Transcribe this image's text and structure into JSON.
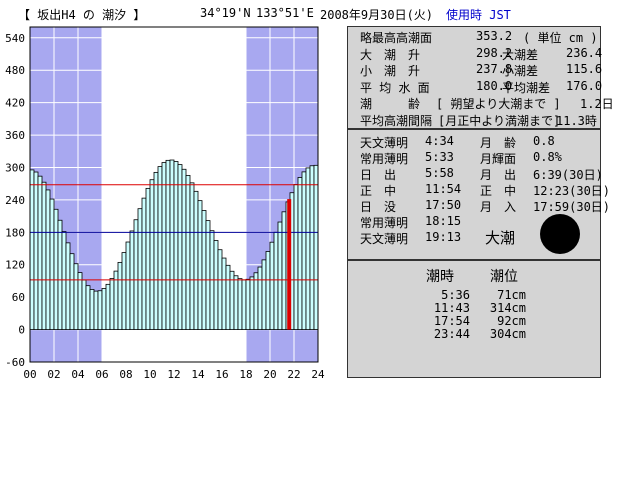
{
  "header": {
    "station": "【 坂出H4 の 潮汐 】",
    "lat": "34°19'N",
    "lon": "133°51'E",
    "date": "2008年9月30日(火)",
    "timezone": "使用時 JST"
  },
  "info_panel": {
    "rows": [
      [
        "略最高高潮面",
        "353.2",
        "( 単位 cm )",
        ""
      ],
      [
        "大　潮　升",
        "298.2",
        "大潮差",
        "236.4"
      ],
      [
        "小　潮　升",
        "237.8",
        "小潮差",
        "115.6"
      ],
      [
        "平 均 水 面",
        "180.0",
        "平均潮差",
        "176.0"
      ],
      [
        "潮　　　齢",
        "[ 朔望より大潮まで ]",
        "1.2日",
        ""
      ],
      [
        "平均高潮間隔",
        "[月正中より満潮まで]",
        "11.3時",
        ""
      ]
    ]
  },
  "astro_panel": {
    "rows": [
      [
        "天文薄明",
        "4:34",
        "月　齢",
        "0.8"
      ],
      [
        "常用薄明",
        "5:33",
        "月輝面",
        "0.8%"
      ],
      [
        "日　出",
        "5:58",
        "月　出",
        "6:39(30日)"
      ],
      [
        "正　中",
        "11:54",
        "正　中",
        "12:23(30日)"
      ],
      [
        "日　没",
        "17:50",
        "月　入",
        "17:59(30日)"
      ],
      [
        "常用薄明",
        "18:15",
        "",
        ""
      ],
      [
        "天文薄明",
        "19:13",
        "",
        ""
      ]
    ],
    "tide_type": "大潮",
    "moon_icon": "new-moon-icon"
  },
  "tide_panel": {
    "head_time": "潮時",
    "head_level": "潮位",
    "events": [
      [
        "5:36",
        "71cm"
      ],
      [
        "11:43",
        "314cm"
      ],
      [
        "17:54",
        "92cm"
      ],
      [
        "23:44",
        "304cm"
      ]
    ]
  },
  "chart_data": {
    "type": "bar",
    "x_unit": "hour",
    "xlim": [
      0,
      24
    ],
    "ylim": [
      -60,
      560
    ],
    "yticks": [
      -60,
      0,
      60,
      120,
      180,
      240,
      300,
      360,
      420,
      480,
      540
    ],
    "xticks": [
      "00",
      "02",
      "04",
      "06",
      "08",
      "10",
      "12",
      "14",
      "16",
      "18",
      "20",
      "22",
      "24"
    ],
    "night_before": 5.97,
    "night_after": 18.0,
    "ref_lines": [
      {
        "value": 268,
        "color": "#dd0000"
      },
      {
        "value": 180,
        "color": "#000099"
      },
      {
        "value": 92,
        "color": "#dd0000"
      }
    ],
    "current_time": 21.6,
    "tide": {
      "mean": 180,
      "hi1": 314,
      "hi1_t": 11.72,
      "lo1": 71,
      "lo1_t": 5.6,
      "lo2": 92,
      "lo2_t": 17.9,
      "hi2": 304,
      "hi2_t": 23.73,
      "start": 296
    },
    "colors": {
      "night": "#a8a8f0",
      "day": "#ffffff",
      "bar_fill": "#ccffff",
      "bar_stroke": "#000000",
      "current": "#dd0000"
    }
  }
}
